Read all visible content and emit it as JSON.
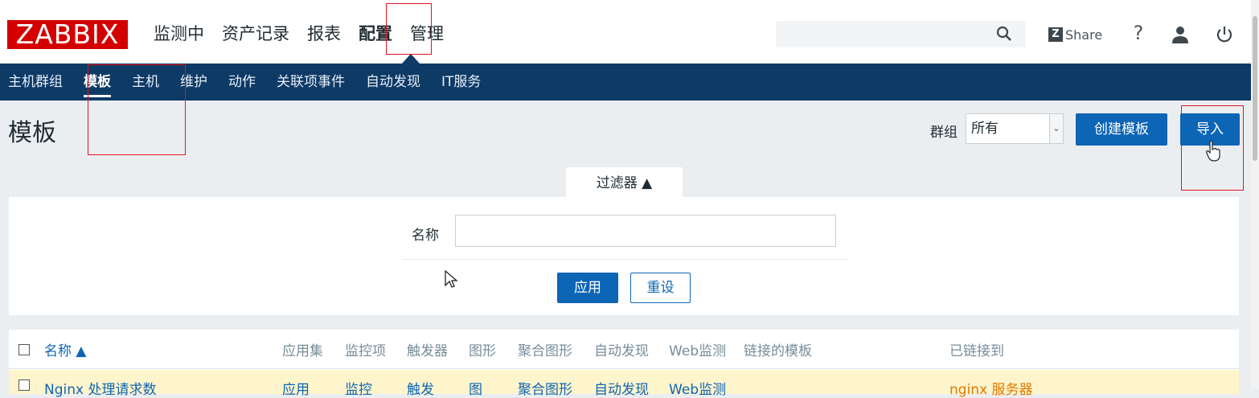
{
  "header": {
    "logo": "ZABBIX",
    "main_nav": [
      "监测中",
      "资产记录",
      "报表",
      "配置",
      "管理"
    ],
    "active_main": "配置",
    "share_label": "Share",
    "help_label": "?"
  },
  "subnav": {
    "items": [
      "主机群组",
      "模板",
      "主机",
      "维护",
      "动作",
      "关联项事件",
      "自动发现",
      "IT服务"
    ],
    "active": "模板"
  },
  "page": {
    "title": "模板",
    "group_label": "群组",
    "group_value": "所有",
    "create_button": "创建模板",
    "import_button": "导入"
  },
  "filter": {
    "tab_label": "过滤器 ▲",
    "name_label": "名称",
    "name_value": "",
    "apply_button": "应用",
    "reset_button": "重设"
  },
  "table": {
    "headers": [
      "名称 ▲",
      "应用集",
      "监控项",
      "触发器",
      "图形",
      "聚合图形",
      "自动发现",
      "Web监测",
      "链接的模板",
      "已链接到"
    ],
    "rows": [
      [
        "Nginx 处理请求数",
        "应用",
        "监控",
        "触发",
        "图",
        "聚合图形",
        "自动发现",
        "Web监测",
        "",
        "nginx 服务器"
      ]
    ]
  },
  "colors": {
    "brand_red": "#d40000",
    "nav_blue": "#0e3a66",
    "button_blue": "#0d65b5",
    "row_highlight": "#fff5cc",
    "annotation_red": "#e0141c"
  }
}
